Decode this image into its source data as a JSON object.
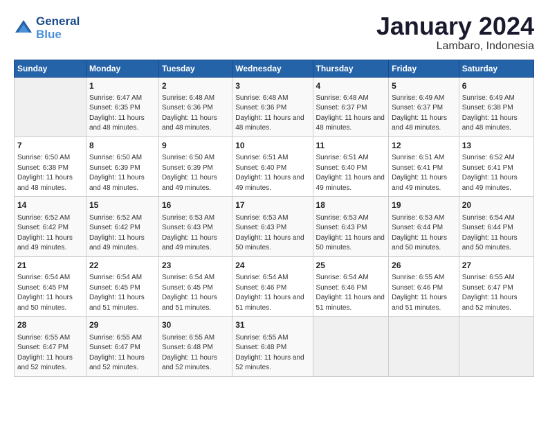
{
  "header": {
    "logo_line1": "General",
    "logo_line2": "Blue",
    "month": "January 2024",
    "location": "Lambaro, Indonesia"
  },
  "weekdays": [
    "Sunday",
    "Monday",
    "Tuesday",
    "Wednesday",
    "Thursday",
    "Friday",
    "Saturday"
  ],
  "weeks": [
    [
      {
        "day": "",
        "sunrise": "",
        "sunset": "",
        "daylight": ""
      },
      {
        "day": "1",
        "sunrise": "Sunrise: 6:47 AM",
        "sunset": "Sunset: 6:35 PM",
        "daylight": "Daylight: 11 hours and 48 minutes."
      },
      {
        "day": "2",
        "sunrise": "Sunrise: 6:48 AM",
        "sunset": "Sunset: 6:36 PM",
        "daylight": "Daylight: 11 hours and 48 minutes."
      },
      {
        "day": "3",
        "sunrise": "Sunrise: 6:48 AM",
        "sunset": "Sunset: 6:36 PM",
        "daylight": "Daylight: 11 hours and 48 minutes."
      },
      {
        "day": "4",
        "sunrise": "Sunrise: 6:48 AM",
        "sunset": "Sunset: 6:37 PM",
        "daylight": "Daylight: 11 hours and 48 minutes."
      },
      {
        "day": "5",
        "sunrise": "Sunrise: 6:49 AM",
        "sunset": "Sunset: 6:37 PM",
        "daylight": "Daylight: 11 hours and 48 minutes."
      },
      {
        "day": "6",
        "sunrise": "Sunrise: 6:49 AM",
        "sunset": "Sunset: 6:38 PM",
        "daylight": "Daylight: 11 hours and 48 minutes."
      }
    ],
    [
      {
        "day": "7",
        "sunrise": "Sunrise: 6:50 AM",
        "sunset": "Sunset: 6:38 PM",
        "daylight": "Daylight: 11 hours and 48 minutes."
      },
      {
        "day": "8",
        "sunrise": "Sunrise: 6:50 AM",
        "sunset": "Sunset: 6:39 PM",
        "daylight": "Daylight: 11 hours and 48 minutes."
      },
      {
        "day": "9",
        "sunrise": "Sunrise: 6:50 AM",
        "sunset": "Sunset: 6:39 PM",
        "daylight": "Daylight: 11 hours and 49 minutes."
      },
      {
        "day": "10",
        "sunrise": "Sunrise: 6:51 AM",
        "sunset": "Sunset: 6:40 PM",
        "daylight": "Daylight: 11 hours and 49 minutes."
      },
      {
        "day": "11",
        "sunrise": "Sunrise: 6:51 AM",
        "sunset": "Sunset: 6:40 PM",
        "daylight": "Daylight: 11 hours and 49 minutes."
      },
      {
        "day": "12",
        "sunrise": "Sunrise: 6:51 AM",
        "sunset": "Sunset: 6:41 PM",
        "daylight": "Daylight: 11 hours and 49 minutes."
      },
      {
        "day": "13",
        "sunrise": "Sunrise: 6:52 AM",
        "sunset": "Sunset: 6:41 PM",
        "daylight": "Daylight: 11 hours and 49 minutes."
      }
    ],
    [
      {
        "day": "14",
        "sunrise": "Sunrise: 6:52 AM",
        "sunset": "Sunset: 6:42 PM",
        "daylight": "Daylight: 11 hours and 49 minutes."
      },
      {
        "day": "15",
        "sunrise": "Sunrise: 6:52 AM",
        "sunset": "Sunset: 6:42 PM",
        "daylight": "Daylight: 11 hours and 49 minutes."
      },
      {
        "day": "16",
        "sunrise": "Sunrise: 6:53 AM",
        "sunset": "Sunset: 6:43 PM",
        "daylight": "Daylight: 11 hours and 49 minutes."
      },
      {
        "day": "17",
        "sunrise": "Sunrise: 6:53 AM",
        "sunset": "Sunset: 6:43 PM",
        "daylight": "Daylight: 11 hours and 50 minutes."
      },
      {
        "day": "18",
        "sunrise": "Sunrise: 6:53 AM",
        "sunset": "Sunset: 6:43 PM",
        "daylight": "Daylight: 11 hours and 50 minutes."
      },
      {
        "day": "19",
        "sunrise": "Sunrise: 6:53 AM",
        "sunset": "Sunset: 6:44 PM",
        "daylight": "Daylight: 11 hours and 50 minutes."
      },
      {
        "day": "20",
        "sunrise": "Sunrise: 6:54 AM",
        "sunset": "Sunset: 6:44 PM",
        "daylight": "Daylight: 11 hours and 50 minutes."
      }
    ],
    [
      {
        "day": "21",
        "sunrise": "Sunrise: 6:54 AM",
        "sunset": "Sunset: 6:45 PM",
        "daylight": "Daylight: 11 hours and 50 minutes."
      },
      {
        "day": "22",
        "sunrise": "Sunrise: 6:54 AM",
        "sunset": "Sunset: 6:45 PM",
        "daylight": "Daylight: 11 hours and 51 minutes."
      },
      {
        "day": "23",
        "sunrise": "Sunrise: 6:54 AM",
        "sunset": "Sunset: 6:45 PM",
        "daylight": "Daylight: 11 hours and 51 minutes."
      },
      {
        "day": "24",
        "sunrise": "Sunrise: 6:54 AM",
        "sunset": "Sunset: 6:46 PM",
        "daylight": "Daylight: 11 hours and 51 minutes."
      },
      {
        "day": "25",
        "sunrise": "Sunrise: 6:54 AM",
        "sunset": "Sunset: 6:46 PM",
        "daylight": "Daylight: 11 hours and 51 minutes."
      },
      {
        "day": "26",
        "sunrise": "Sunrise: 6:55 AM",
        "sunset": "Sunset: 6:46 PM",
        "daylight": "Daylight: 11 hours and 51 minutes."
      },
      {
        "day": "27",
        "sunrise": "Sunrise: 6:55 AM",
        "sunset": "Sunset: 6:47 PM",
        "daylight": "Daylight: 11 hours and 52 minutes."
      }
    ],
    [
      {
        "day": "28",
        "sunrise": "Sunrise: 6:55 AM",
        "sunset": "Sunset: 6:47 PM",
        "daylight": "Daylight: 11 hours and 52 minutes."
      },
      {
        "day": "29",
        "sunrise": "Sunrise: 6:55 AM",
        "sunset": "Sunset: 6:47 PM",
        "daylight": "Daylight: 11 hours and 52 minutes."
      },
      {
        "day": "30",
        "sunrise": "Sunrise: 6:55 AM",
        "sunset": "Sunset: 6:48 PM",
        "daylight": "Daylight: 11 hours and 52 minutes."
      },
      {
        "day": "31",
        "sunrise": "Sunrise: 6:55 AM",
        "sunset": "Sunset: 6:48 PM",
        "daylight": "Daylight: 11 hours and 52 minutes."
      },
      {
        "day": "",
        "sunrise": "",
        "sunset": "",
        "daylight": ""
      },
      {
        "day": "",
        "sunrise": "",
        "sunset": "",
        "daylight": ""
      },
      {
        "day": "",
        "sunrise": "",
        "sunset": "",
        "daylight": ""
      }
    ]
  ]
}
